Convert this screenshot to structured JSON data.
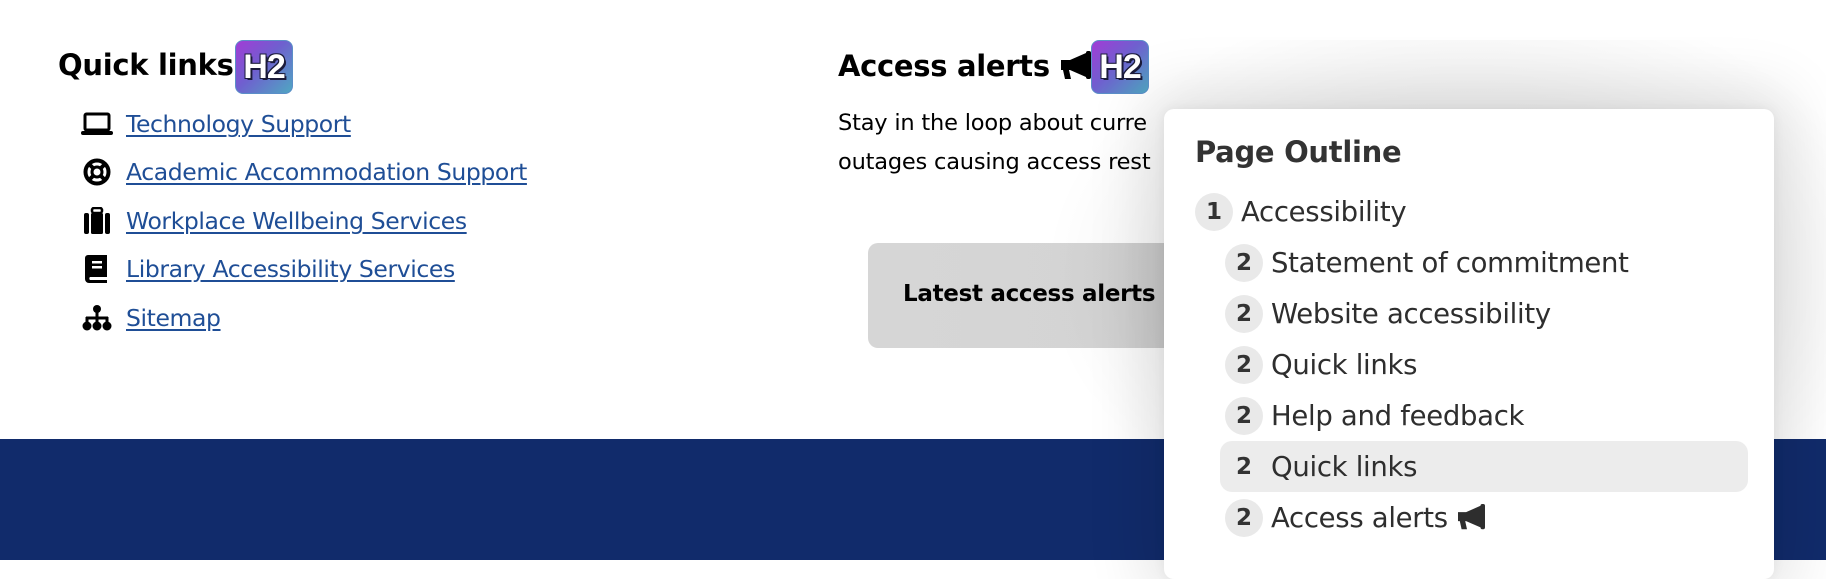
{
  "quick_links": {
    "heading": "Quick links",
    "heading_badge": "H2",
    "items": [
      {
        "label": "Technology Support",
        "icon": "laptop-icon"
      },
      {
        "label": "Academic Accommodation Support",
        "icon": "life-ring-icon"
      },
      {
        "label": "Workplace Wellbeing Services",
        "icon": "suitcase-icon"
      },
      {
        "label": "Library Accessibility Services",
        "icon": "book-icon"
      },
      {
        "label": "Sitemap",
        "icon": "sitemap-icon"
      }
    ]
  },
  "access_alerts": {
    "heading": "Access alerts",
    "heading_icon": "megaphone-icon",
    "heading_badge": "H2",
    "paragraph_line1": "Stay in the loop about curre",
    "paragraph_line2": "outages causing access rest",
    "button_label": "Latest access alerts"
  },
  "page_outline": {
    "title": "Page Outline",
    "items": [
      {
        "level": "1",
        "label": "Accessibility",
        "highlighted": false
      },
      {
        "level": "2",
        "label": "Statement of commitment",
        "highlighted": false
      },
      {
        "level": "2",
        "label": "Website accessibility",
        "highlighted": false
      },
      {
        "level": "2",
        "label": "Quick links",
        "highlighted": false
      },
      {
        "level": "2",
        "label": "Help and feedback",
        "highlighted": false
      },
      {
        "level": "2",
        "label": "Quick links",
        "highlighted": true
      },
      {
        "level": "2",
        "label": "Access alerts",
        "highlighted": false,
        "icon": "megaphone-icon"
      }
    ]
  },
  "colors": {
    "link": "#1f4e96",
    "footer": "#112b6b",
    "badge_gradient_start": "#a13cd6",
    "badge_gradient_end": "#4fa7c2",
    "outline_highlight": "#ececec"
  }
}
